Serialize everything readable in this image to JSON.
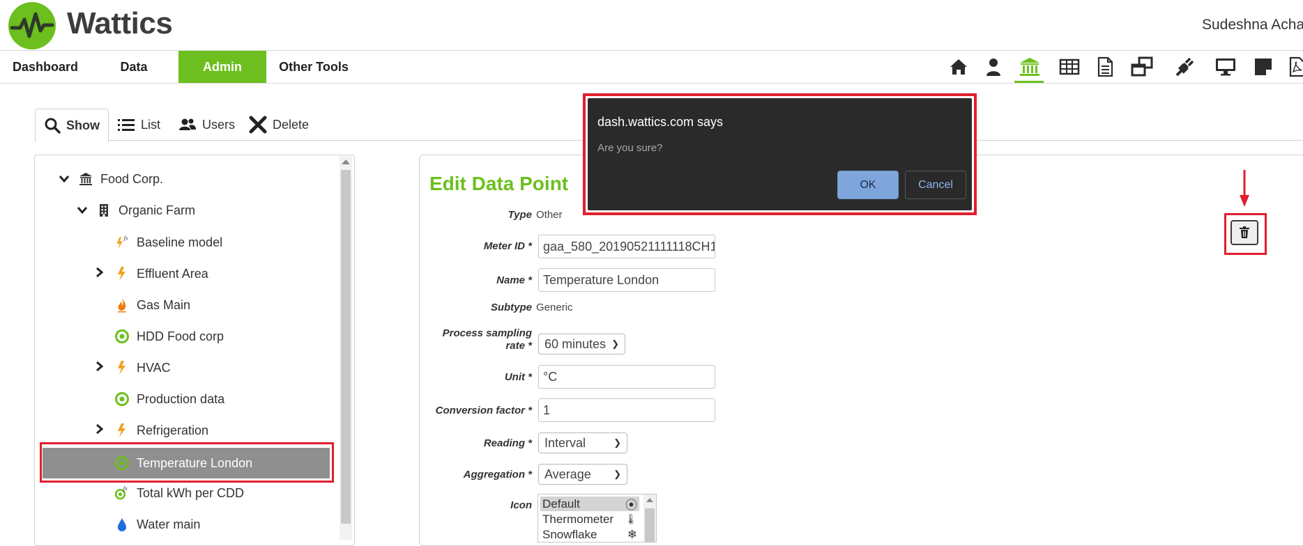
{
  "header": {
    "logo_text": "Wattics",
    "user_name": "Sudeshna Achar"
  },
  "nav": {
    "items": [
      "Dashboard",
      "Data",
      "Admin",
      "Other Tools"
    ],
    "active": "Admin"
  },
  "toolbar_icons": [
    "home-icon",
    "user-icon",
    "building-icon",
    "table-icon",
    "document-icon",
    "windows-icon",
    "plug-icon",
    "monitor-icon",
    "note-icon",
    "pdf-icon"
  ],
  "tabs": [
    "Show",
    "List",
    "Users",
    "Delete"
  ],
  "tree": {
    "root": "Food Corp.",
    "site": "Organic Farm",
    "items": [
      "Baseline model",
      "Effluent Area",
      "Gas Main",
      "HDD Food corp",
      "HVAC",
      "Production data",
      "Refrigeration",
      "Temperature London",
      "Total kWh per CDD",
      "Water main"
    ],
    "selected": "Temperature London"
  },
  "form": {
    "title": "Edit Data Point",
    "type_label": "Type",
    "type_value": "Other",
    "meter_label": "Meter ID *",
    "meter_value": "gaa_580_20190521111118CH1",
    "name_label": "Name *",
    "name_value": "Temperature London",
    "subtype_label": "Subtype",
    "subtype_value": "Generic",
    "sampling_label_1": "Process sampling",
    "sampling_label_2": "rate *",
    "sampling_value": "60 minutes",
    "unit_label": "Unit *",
    "unit_value": "°C",
    "factor_label": "Conversion factor *",
    "factor_value": "1",
    "reading_label": "Reading *",
    "reading_value": "Interval",
    "aggregation_label": "Aggregation *",
    "aggregation_value": "Average",
    "icon_label": "Icon",
    "icon_options": [
      "Default",
      "Thermometer",
      "Snowflake"
    ],
    "icon_glyphs": [
      "⦿",
      "🌡",
      "❄"
    ]
  },
  "dialog": {
    "title": "dash.wattics.com says",
    "message": "Are you sure?",
    "ok": "OK",
    "cancel": "Cancel"
  },
  "colors": {
    "brand_green": "#6cbf1e",
    "highlight_red": "#e01e2d",
    "dialog_bg": "#2a2a2a",
    "bolt_orange": "#f0a020",
    "drop_blue": "#1e6fd9"
  }
}
